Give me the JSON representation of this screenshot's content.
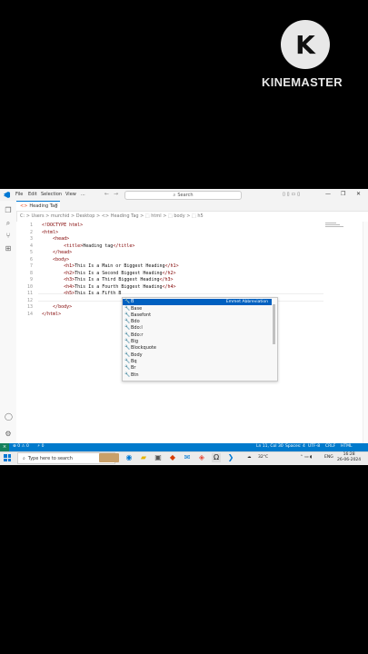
{
  "watermark": {
    "logo_letter": "K",
    "text": "KINEMASTER"
  },
  "titlebar": {
    "menu": [
      "File",
      "Edit",
      "Selection",
      "View",
      "..."
    ],
    "nav_back": "←",
    "nav_forward": "→",
    "search_placeholder": "Search",
    "window_controls": [
      "—",
      "❐",
      "✕"
    ]
  },
  "tab": {
    "label": "Heading Tag",
    "close": "×"
  },
  "breadcrumb": "C: > Users > murchid > Desktop > <> Heading Tag > ⬚ html > ⬚ body > ⬚ h5",
  "editor": {
    "line_numbers": [
      "1",
      "2",
      "3",
      "4",
      "5",
      "6",
      "7",
      "8",
      "9",
      "10",
      "11",
      "12",
      "13",
      "14"
    ],
    "lines": [
      {
        "indent": "",
        "parts": [
          {
            "c": "br",
            "t": "<!DOCTYPE "
          },
          {
            "c": "tag",
            "t": "html"
          },
          {
            "c": "br",
            "t": ">"
          }
        ]
      },
      {
        "indent": "",
        "parts": [
          {
            "c": "br",
            "t": "<"
          },
          {
            "c": "tag",
            "t": "html"
          },
          {
            "c": "br",
            "t": ">"
          }
        ]
      },
      {
        "indent": "    ",
        "parts": [
          {
            "c": "br",
            "t": "<"
          },
          {
            "c": "tag",
            "t": "head"
          },
          {
            "c": "br",
            "t": ">"
          }
        ]
      },
      {
        "indent": "        ",
        "parts": [
          {
            "c": "br",
            "t": "<"
          },
          {
            "c": "tag",
            "t": "title"
          },
          {
            "c": "br",
            "t": ">"
          },
          {
            "c": "txt",
            "t": "Heading tag"
          },
          {
            "c": "br",
            "t": "</"
          },
          {
            "c": "tag",
            "t": "title"
          },
          {
            "c": "br",
            "t": ">"
          }
        ]
      },
      {
        "indent": "    ",
        "parts": [
          {
            "c": "br",
            "t": "</"
          },
          {
            "c": "tag",
            "t": "head"
          },
          {
            "c": "br",
            "t": ">"
          }
        ]
      },
      {
        "indent": "    ",
        "parts": [
          {
            "c": "br",
            "t": "<"
          },
          {
            "c": "tag",
            "t": "body"
          },
          {
            "c": "br",
            "t": ">"
          }
        ]
      },
      {
        "indent": "        ",
        "parts": [
          {
            "c": "br",
            "t": "<"
          },
          {
            "c": "tag",
            "t": "h1"
          },
          {
            "c": "br",
            "t": ">"
          },
          {
            "c": "txt",
            "t": "This Is a Main or Biggest Heading"
          },
          {
            "c": "br",
            "t": "</"
          },
          {
            "c": "tag",
            "t": "h1"
          },
          {
            "c": "br",
            "t": ">"
          }
        ]
      },
      {
        "indent": "        ",
        "parts": [
          {
            "c": "br",
            "t": "<"
          },
          {
            "c": "tag",
            "t": "h2"
          },
          {
            "c": "br",
            "t": ">"
          },
          {
            "c": "txt",
            "t": "This Is a Second Biggest Heading"
          },
          {
            "c": "br",
            "t": "</"
          },
          {
            "c": "tag",
            "t": "h2"
          },
          {
            "c": "br",
            "t": ">"
          }
        ]
      },
      {
        "indent": "        ",
        "parts": [
          {
            "c": "br",
            "t": "<"
          },
          {
            "c": "tag",
            "t": "h3"
          },
          {
            "c": "br",
            "t": ">"
          },
          {
            "c": "txt",
            "t": "This Is a Third Biggest Heading"
          },
          {
            "c": "br",
            "t": "</"
          },
          {
            "c": "tag",
            "t": "h3"
          },
          {
            "c": "br",
            "t": ">"
          }
        ]
      },
      {
        "indent": "        ",
        "parts": [
          {
            "c": "br",
            "t": "<"
          },
          {
            "c": "tag",
            "t": "h4"
          },
          {
            "c": "br",
            "t": ">"
          },
          {
            "c": "txt",
            "t": "This Is a Fourth Biggest Heading"
          },
          {
            "c": "br",
            "t": "</"
          },
          {
            "c": "tag",
            "t": "h4"
          },
          {
            "c": "br",
            "t": ">"
          }
        ]
      },
      {
        "indent": "        ",
        "parts": [
          {
            "c": "br",
            "t": "<"
          },
          {
            "c": "tag",
            "t": "h5"
          },
          {
            "c": "br",
            "t": ">"
          },
          {
            "c": "txt",
            "t": "This Is a Fifth B"
          }
        ]
      },
      {
        "indent": "",
        "parts": []
      },
      {
        "indent": "    ",
        "parts": [
          {
            "c": "br",
            "t": "</"
          },
          {
            "c": "tag",
            "t": "body"
          },
          {
            "c": "br",
            "t": ">"
          }
        ]
      },
      {
        "indent": "",
        "parts": [
          {
            "c": "br",
            "t": "</"
          },
          {
            "c": "tag",
            "t": "html"
          },
          {
            "c": "br",
            "t": ">"
          }
        ]
      }
    ]
  },
  "suggestions": {
    "selected_detail": "Emmet Abbreviation",
    "items": [
      "B",
      "Base",
      "Basefont",
      "Bdo",
      "Bdo:l",
      "Bdo:r",
      "Big",
      "Blockquote",
      "Body",
      "Bq",
      "Br",
      "Btn"
    ]
  },
  "statusbar": {
    "remote": "⨯",
    "problems": "⊗ 0 ⚠ 0",
    "ports": "⚡ 0",
    "position": "Ln 11, Col 30",
    "spaces": "Spaces: 4",
    "encoding": "UTF-8",
    "eol": "CRLF",
    "language": "HTML"
  },
  "taskbar": {
    "search_placeholder": "Type here to search",
    "weather": "32°C",
    "lang": "ENG",
    "time": "16:28",
    "date": "26-06-2024"
  },
  "colors": {
    "accent": "#007acc",
    "selection": "#0060c0",
    "remote": "#16825d",
    "tag": "#800000"
  }
}
